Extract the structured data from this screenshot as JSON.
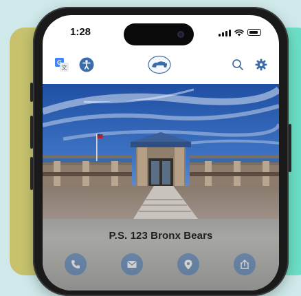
{
  "status_bar": {
    "time": "1:28",
    "icons": [
      "cellular-signal-icon",
      "wifi-icon",
      "battery-icon"
    ]
  },
  "header": {
    "left_icons": [
      "translate-icon",
      "accessibility-icon"
    ],
    "logo": "school-logo-bear",
    "right_icons": [
      "search-icon",
      "settings-gear-icon"
    ],
    "accent_color": "#3b6ca8"
  },
  "hero": {
    "image": "school-building-photo"
  },
  "school": {
    "name": "P.S. 123 Bronx Bears"
  },
  "quick_actions": [
    "phone-icon",
    "mail-icon",
    "location-pin-icon",
    "share-icon"
  ],
  "colors": {
    "background_gradient": [
      "#c9c06a",
      "#8fe0c0",
      "#63dfc8"
    ],
    "icon_blue": "#3b6ca8"
  }
}
